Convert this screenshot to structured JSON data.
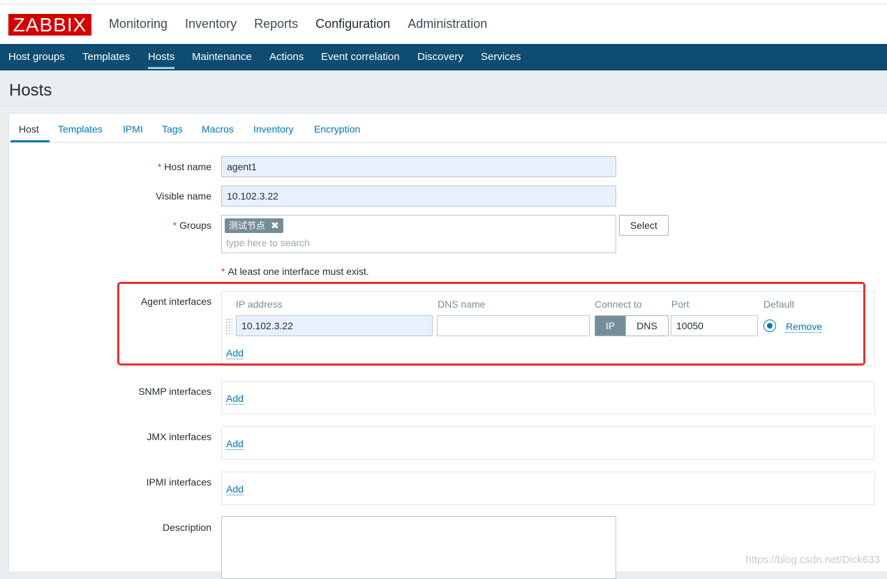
{
  "header": {
    "logo": "ZABBIX",
    "main_nav": [
      "Monitoring",
      "Inventory",
      "Reports",
      "Configuration",
      "Administration"
    ],
    "active_main": "Configuration",
    "sub_nav": [
      "Host groups",
      "Templates",
      "Hosts",
      "Maintenance",
      "Actions",
      "Event correlation",
      "Discovery",
      "Services"
    ],
    "active_sub": "Hosts"
  },
  "page": {
    "title": "Hosts"
  },
  "tabs": [
    "Host",
    "Templates",
    "IPMI",
    "Tags",
    "Macros",
    "Inventory",
    "Encryption"
  ],
  "form": {
    "host_name": {
      "label": "Host name",
      "value": "agent1",
      "required": "*"
    },
    "visible_name": {
      "label": "Visible name",
      "value": "10.102.3.22"
    },
    "groups": {
      "label": "Groups",
      "required": "*",
      "chip": "测试节点",
      "chip_remove": "✖",
      "placeholder": "type here to search",
      "select_button": "Select"
    },
    "interface_hint": {
      "star": "*",
      "text": "At least one interface must exist."
    },
    "agent_interfaces": {
      "label": "Agent interfaces",
      "columns": [
        "IP address",
        "DNS name",
        "Connect to",
        "Port",
        "Default"
      ],
      "row": {
        "ip": "10.102.3.22",
        "dns": "",
        "connect_ip": "IP",
        "connect_dns": "DNS",
        "port": "10050",
        "remove": "Remove"
      },
      "add": "Add"
    },
    "snmp_interfaces": {
      "label": "SNMP interfaces",
      "add": "Add"
    },
    "jmx_interfaces": {
      "label": "JMX interfaces",
      "add": "Add"
    },
    "ipmi_interfaces": {
      "label": "IPMI interfaces",
      "add": "Add"
    },
    "description": {
      "label": "Description",
      "value": ""
    }
  },
  "watermark": "https://blog.csdn.net/Dick633",
  "colors": {
    "brand_red": "#d40000",
    "subnav_blue": "#0e4c71",
    "link_blue": "#0275b8",
    "highlight_red": "#e8312b"
  }
}
